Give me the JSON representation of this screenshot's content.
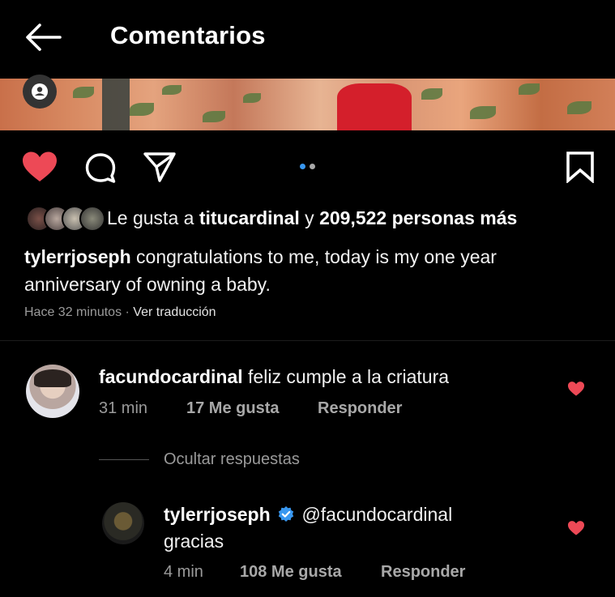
{
  "header": {
    "title": "Comentarios",
    "back_icon": "arrow-left-icon"
  },
  "post": {
    "image_strip_colors": {
      "accent_red": "#d41f2b",
      "leaf_green": "#5f7a43"
    },
    "actions": {
      "like_icon": "heart-filled-icon",
      "comment_icon": "comment-icon",
      "share_icon": "paper-plane-icon",
      "save_icon": "bookmark-icon",
      "carousel": {
        "count": 2,
        "active_index": 0
      }
    },
    "likes": {
      "prefix": "Le gusta a",
      "user": "titucardinal",
      "joiner": "y",
      "others": "209,522 personas más"
    },
    "caption": {
      "username": "tylerrjoseph",
      "text": "congratulations to me, today is my one year anniversary of owning a baby."
    },
    "time": "Hace 32 minutos",
    "separator": "·",
    "translate": "Ver traducción"
  },
  "comments": [
    {
      "username": "facundocardinal",
      "text": "feliz cumple a la criatura",
      "time": "31 min",
      "likes": "17 Me gusta",
      "reply": "Responder",
      "liked": true,
      "hide_replies": "Ocultar respuestas",
      "replies": [
        {
          "username": "tylerrjoseph",
          "verified": true,
          "mention": "@facundocardinal",
          "text": "gracias",
          "time": "4 min",
          "likes": "108 Me gusta",
          "reply": "Responder",
          "liked": true
        }
      ]
    }
  ],
  "colors": {
    "like_red": "#ed4956",
    "verified_blue": "#3897f0",
    "dot_active": "#3897f0",
    "dot_inactive": "#a8a8a8"
  }
}
